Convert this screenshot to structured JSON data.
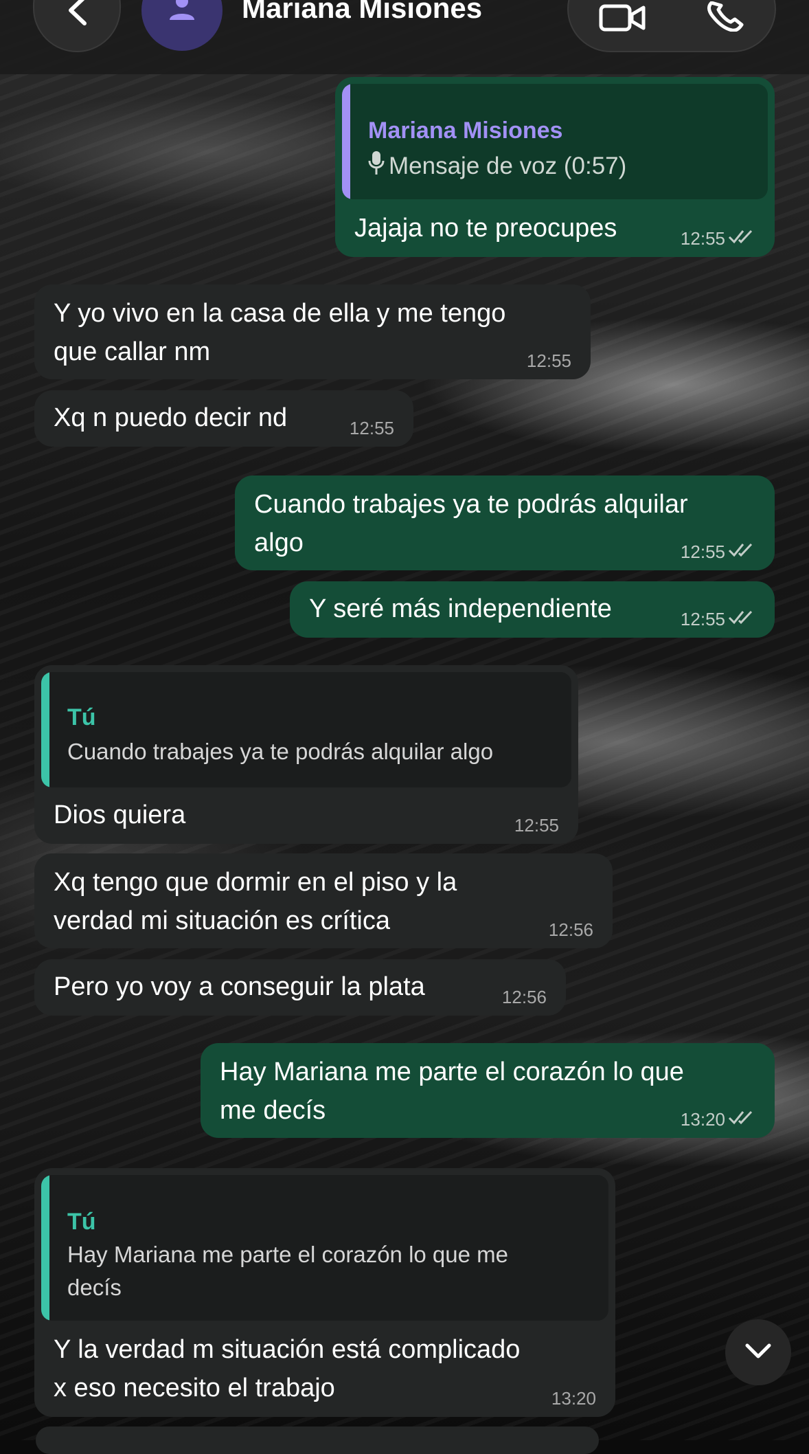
{
  "header": {
    "contact_name": "Mariana Misiones",
    "back_icon": "chevron-left-icon",
    "avatar_icon": "person-icon",
    "video_icon": "video-camera-icon",
    "phone_icon": "phone-icon"
  },
  "colors": {
    "outgoing_bubble": "#144d37",
    "incoming_bubble": "#242626",
    "quote_name_purple": "#a291f5",
    "quote_name_teal": "#3cc4a8"
  },
  "messages": [
    {
      "direction": "out",
      "quote": {
        "name": "Mariana Misiones",
        "icon": "microphone-icon",
        "text": "Mensaje de voz (0:57)"
      },
      "lines": [
        "Jajaja no te preocupes"
      ],
      "time": "12:55",
      "status": "read"
    },
    {
      "direction": "in",
      "lines": [
        "Y yo vivo en la casa de ella y me tengo",
        "que callar nm"
      ],
      "time": "12:55"
    },
    {
      "direction": "in",
      "lines": [
        "Xq n puedo decir nd"
      ],
      "time": "12:55"
    },
    {
      "direction": "out",
      "lines": [
        "Cuando trabajes ya te podrás alquilar",
        "algo"
      ],
      "time": "12:55",
      "status": "read"
    },
    {
      "direction": "out",
      "lines": [
        "Y seré más independiente"
      ],
      "time": "12:55",
      "status": "read"
    },
    {
      "direction": "in",
      "quote": {
        "name": "Tú",
        "lines": [
          "Cuando trabajes ya te podrás alquilar algo"
        ]
      },
      "lines": [
        "Dios quiera"
      ],
      "time": "12:55"
    },
    {
      "direction": "in",
      "lines": [
        "Xq tengo que dormir en el piso y la",
        "verdad mi situación es crítica"
      ],
      "time": "12:56"
    },
    {
      "direction": "in",
      "lines": [
        "Pero yo voy a conseguir la plata"
      ],
      "time": "12:56"
    },
    {
      "direction": "out",
      "lines": [
        "Hay Mariana me parte el corazón lo que",
        "me decís"
      ],
      "time": "13:20",
      "status": "read"
    },
    {
      "direction": "in",
      "quote": {
        "name": "Tú",
        "lines": [
          "Hay Mariana me parte el corazón lo que me",
          "decís"
        ]
      },
      "lines": [
        "Y la verdad m situación está complicado",
        "x eso necesito el trabajo"
      ],
      "time": "13:20"
    }
  ],
  "scroll_down_icon": "chevron-down-icon"
}
